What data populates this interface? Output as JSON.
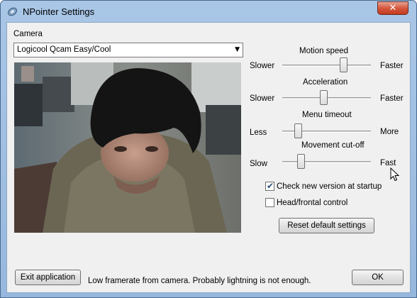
{
  "window": {
    "title": "NPointer Settings",
    "close_label": "✕"
  },
  "camera": {
    "label": "Camera",
    "selected": "Logicool Qcam Easy/Cool"
  },
  "sliders": [
    {
      "title": "Motion speed",
      "min_label": "Slower",
      "max_label": "Faster",
      "value_fraction": 0.69
    },
    {
      "title": "Acceleration",
      "min_label": "Slower",
      "max_label": "Faster",
      "value_fraction": 0.47
    },
    {
      "title": "Menu timeout",
      "min_label": "Less",
      "max_label": "More",
      "value_fraction": 0.18
    },
    {
      "title": "Movement cut-off",
      "min_label": "Slow",
      "max_label": "Fast",
      "value_fraction": 0.21
    }
  ],
  "options": {
    "check_new_version": {
      "label": "Check new version at startup",
      "checked": true
    },
    "head_frontal": {
      "label": "Head/frontal control",
      "checked": false
    }
  },
  "buttons": {
    "reset": "Reset default settings",
    "exit": "Exit application",
    "ok": "OK"
  },
  "status": {
    "message": "Low framerate from camera. Probably lightning is not enough."
  },
  "colors": {
    "title_bar": "#a9c6e6",
    "client_bg": "#f0f0f0",
    "close_button": "#d5573d",
    "checkmark": "#2a4d7a"
  }
}
